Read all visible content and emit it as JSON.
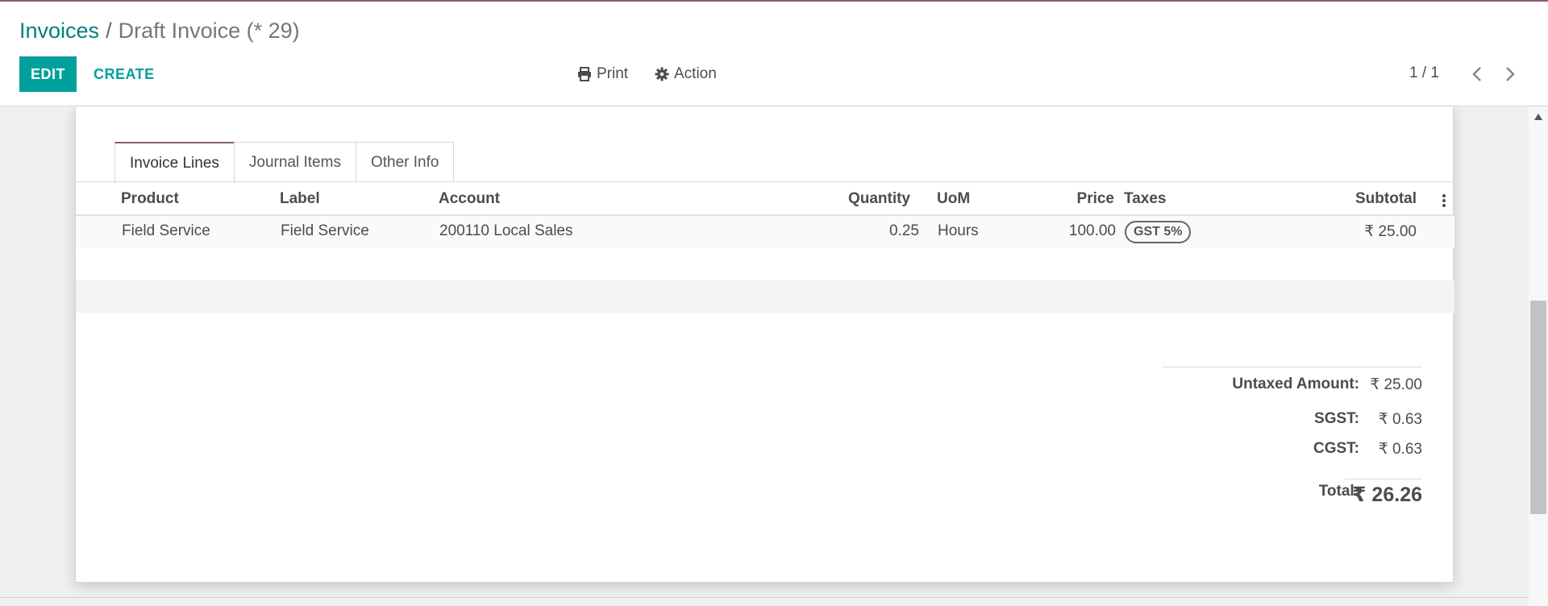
{
  "breadcrumb": {
    "parent": "Invoices",
    "separator": "/",
    "current": "Draft Invoice (* 29)"
  },
  "toolbar": {
    "edit_label": "EDIT",
    "create_label": "CREATE",
    "print_label": "Print",
    "action_label": "Action"
  },
  "pager": {
    "value": "1 / 1"
  },
  "tabs": [
    {
      "label": "Invoice Lines",
      "active": true
    },
    {
      "label": "Journal Items",
      "active": false
    },
    {
      "label": "Other Info",
      "active": false
    }
  ],
  "table": {
    "columns": [
      "Product",
      "Label",
      "Account",
      "Quantity",
      "UoM",
      "Price",
      "Taxes",
      "Subtotal"
    ],
    "rows": [
      {
        "product": "Field Service",
        "label": "Field Service",
        "account": "200110 Local Sales",
        "quantity": "0.25",
        "uom": "Hours",
        "price": "100.00",
        "tax": "GST 5%",
        "subtotal": "₹ 25.00"
      }
    ]
  },
  "totals": {
    "untaxed_label": "Untaxed Amount:",
    "untaxed_value": "₹ 25.00",
    "sgst_label": "SGST:",
    "sgst_value": "₹ 0.63",
    "cgst_label": "CGST:",
    "cgst_value": "₹ 0.63",
    "total_label": "Total:",
    "total_value": "₹ 26.26"
  },
  "colors": {
    "brand": "#875a7b",
    "primary": "#00a09d",
    "link": "#017e84"
  },
  "icons": {
    "print": "print-icon",
    "action": "gear-icon",
    "prev": "chevron-left-icon",
    "next": "chevron-right-icon",
    "options": "kebab-icon"
  }
}
